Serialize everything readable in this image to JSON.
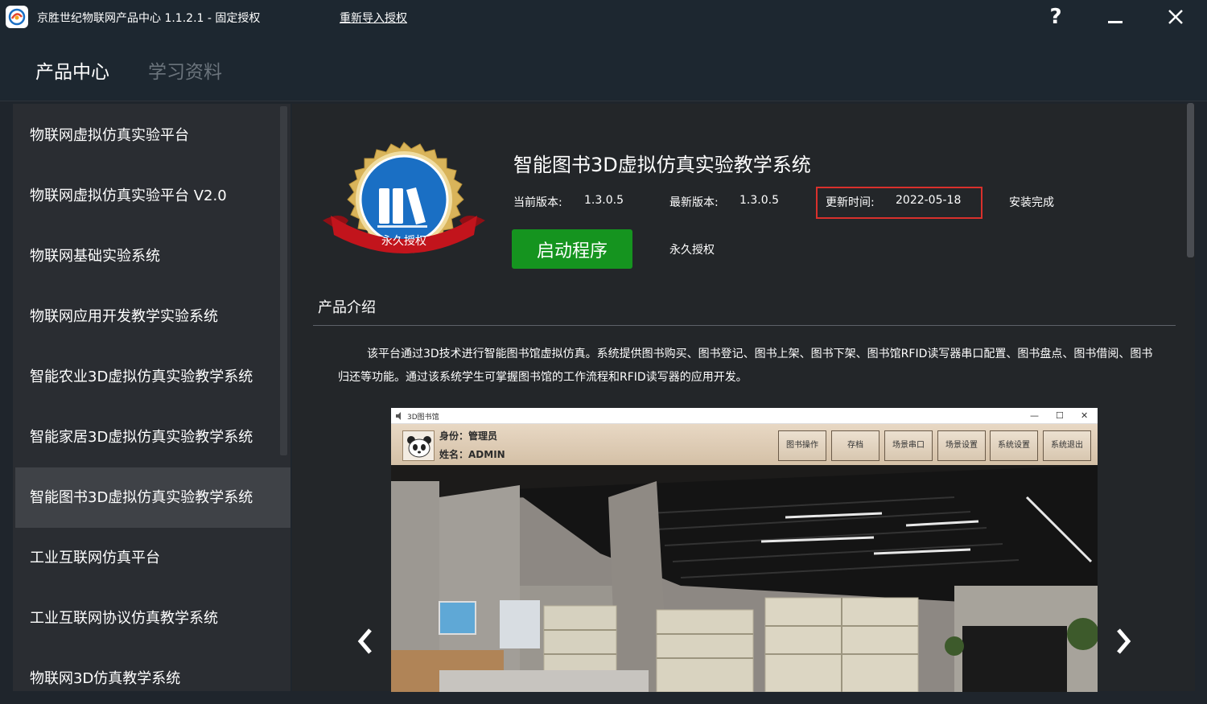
{
  "window": {
    "title": "京胜世纪物联网产品中心 1.1.2.1 - 固定授权",
    "reimport_link": "重新导入授权",
    "help_glyph": "?"
  },
  "nav": {
    "tabs": [
      {
        "label": "产品中心",
        "active": true
      },
      {
        "label": "学习资料",
        "active": false
      }
    ]
  },
  "sidebar": {
    "selected_index": 6,
    "items": [
      {
        "label": "物联网虚拟仿真实验平台"
      },
      {
        "label": "物联网虚拟仿真实验平台 V2.0"
      },
      {
        "label": "物联网基础实验系统"
      },
      {
        "label": "物联网应用开发教学实验系统"
      },
      {
        "label": "智能农业3D虚拟仿真实验教学系统"
      },
      {
        "label": "智能家居3D虚拟仿真实验教学系统"
      },
      {
        "label": "智能图书3D虚拟仿真实验教学系统"
      },
      {
        "label": "工业互联网仿真平台"
      },
      {
        "label": "工业互联网协议仿真教学系统"
      },
      {
        "label": "物联网3D仿真教学系统"
      }
    ]
  },
  "product": {
    "badge_label": "永久授权",
    "title": "智能图书3D虚拟仿真实验教学系统",
    "current_version_label": "当前版本:",
    "current_version": "1.3.0.5",
    "latest_version_label": "最新版本:",
    "latest_version": "1.3.0.5",
    "update_time_label": "更新时间:",
    "update_time": "2022-05-18",
    "install_status": "安装完成",
    "launch_label": "启动程序",
    "license": "永久授权",
    "section_title": "产品介绍",
    "description": "该平台通过3D技术进行智能图书馆虚拟仿真。系统提供图书购买、图书登记、图书上架、图书下架、图书馆RFID读写器串口配置、图书盘点、图书借阅、图书归还等功能。通过该系统学生可掌握图书馆的工作流程和RFID读写器的应用开发。"
  },
  "preview": {
    "window_title": "3D图书馆",
    "identity": "身份：管理员",
    "name": "姓名：ADMIN",
    "buttons": [
      "图书操作",
      "存档",
      "场景串口",
      "场景设置",
      "系统设置",
      "系统退出"
    ],
    "win_min": "—",
    "win_max": "☐",
    "win_close": "✕"
  },
  "colors": {
    "accent_green": "#15941f",
    "highlight_red": "#d9302c",
    "badge_blue": "#1a6fc4",
    "ribbon_red": "#c2141c",
    "gold": "#d9b45a"
  }
}
